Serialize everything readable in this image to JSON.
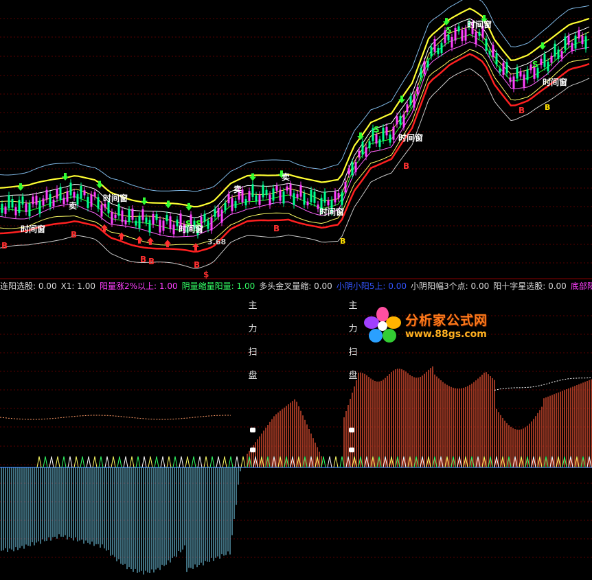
{
  "chart_data": [
    {
      "type": "line",
      "panel": "main-candlestick",
      "description_visible": "price candles with envelope bands and buy/sell markers",
      "colors": {
        "upper_band": "#7fb8e6",
        "yellow_band": "#ffff33",
        "red_band": "#ff2020",
        "candle_up": "#ff40ff",
        "candle_down": "#00ff90"
      },
      "labels": {
        "price_marker": "3.68",
        "buy": "B",
        "sell": "S",
        "dollar": "$",
        "sell_cn": "卖",
        "window": "时间窗"
      }
    },
    {
      "type": "bar",
      "panel": "indicator-histogram",
      "colors": {
        "positive": "#ff5a3a",
        "negative": "#7fe0ff",
        "baseline": "#3a7fff"
      },
      "vertical_text": [
        "主",
        "力",
        "扫",
        "盘"
      ]
    }
  ],
  "indicator_bar": [
    {
      "label": "连阳选股: 0.00",
      "color": "#d9d9d9"
    },
    {
      "label": "X1: 1.00",
      "color": "#d9d9d9"
    },
    {
      "label": "阳量涨2%以上: 1.00",
      "color": "#ff40ff"
    },
    {
      "label": "阴量缩量阳量: 1.00",
      "color": "#33ff66"
    },
    {
      "label": "多头金叉量缩: 0.00",
      "color": "#d9d9d9"
    },
    {
      "label": "小阴小阳5上: 0.00",
      "color": "#3355ff"
    },
    {
      "label": "小阴阳幅3个点: 0.00",
      "color": "#d9d9d9"
    },
    {
      "label": "阳十字星选股: 0.00",
      "color": "#d9d9d9"
    },
    {
      "label": "底部阳包阴",
      "color": "#ff40ff"
    }
  ],
  "vertical_labels": {
    "left": [
      "主",
      "力",
      "扫",
      "盘"
    ],
    "right": [
      "主",
      "力",
      "扫",
      "盘"
    ]
  },
  "watermark": {
    "title": "分析家公式网",
    "url": "www.88gs.com"
  }
}
